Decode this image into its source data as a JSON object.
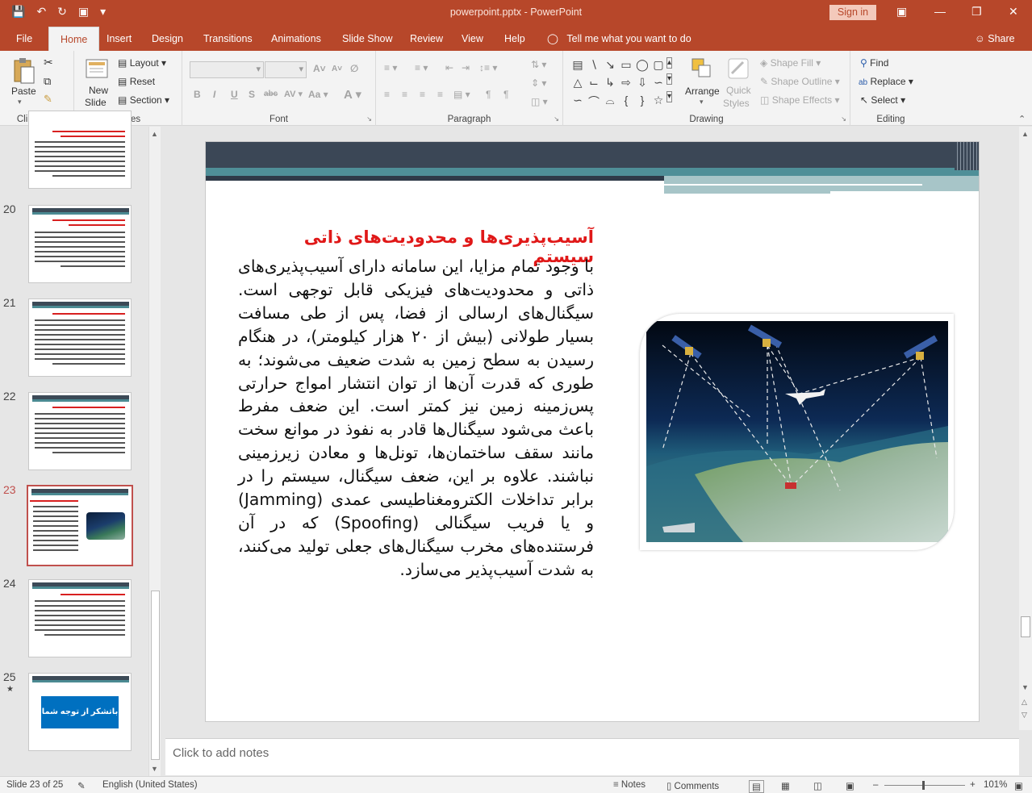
{
  "titlebar": {
    "title": "powerpoint.pptx - PowerPoint",
    "signin": "Sign in"
  },
  "tabs": [
    "File",
    "Home",
    "Insert",
    "Design",
    "Transitions",
    "Animations",
    "Slide Show",
    "Review",
    "View",
    "Help"
  ],
  "active_tab": "Home",
  "tellme": "Tell me what you want to do",
  "share": "Share",
  "ribbon": {
    "clipboard": {
      "label": "Clipboard",
      "paste": "Paste"
    },
    "slides": {
      "label": "Slides",
      "new_slide": "New",
      "new_slide2": "Slide",
      "layout": "Layout",
      "reset": "Reset",
      "section": "Section"
    },
    "font": {
      "label": "Font"
    },
    "paragraph": {
      "label": "Paragraph"
    },
    "drawing": {
      "label": "Drawing",
      "arrange": "Arrange",
      "quick_styles": "Quick",
      "quick_styles2": "Styles",
      "shape_fill": "Shape Fill",
      "shape_outline": "Shape Outline",
      "shape_effects": "Shape Effects"
    },
    "editing": {
      "label": "Editing",
      "find": "Find",
      "replace": "Replace",
      "select": "Select"
    }
  },
  "thumbnails": [
    {
      "num": "20"
    },
    {
      "num": "21"
    },
    {
      "num": "22"
    },
    {
      "num": "23"
    },
    {
      "num": "24"
    },
    {
      "num": "25",
      "text": "باتشکر از توجه شما"
    }
  ],
  "slide": {
    "title": "آسیب‌پذیری‌ها و محدودیت‌های ذاتی سیستم",
    "body": "با وجود تمام مزایا، این سامانه دارای آسیب‌پذیری‌های ذاتی و محدودیت‌های فیزیکی قابل توجهی است. سیگنال‌های ارسالی از فضا، پس از طی مسافت بسیار طولانی (بیش از ۲۰ هزار کیلومتر)، در هنگام رسیدن به سطح زمین به شدت ضعیف می‌شوند؛ به طوری که قدرت آن‌ها از توان انتشار امواج حرارتی پس‌زمینه زمین نیز کمتر است. این ضعف مفرط باعث می‌شود سیگنال‌ها قادر به نفوذ در موانع سخت مانند سقف ساختمان‌ها، تونل‌ها و معادن زیرزمینی نباشند. علاوه بر این، ضعف سیگنال، سیستم را در برابر تداخلات الکترومغناطیسی عمدی (Jamming) و یا فریب سیگنالی (Spoofing) که در آن فرستنده‌های مخرب سیگنال‌های جعلی تولید می‌کنند، به شدت آسیب‌پذیر می‌سازد."
  },
  "notes": {
    "placeholder": "Click to add notes"
  },
  "statusbar": {
    "slide_count": "Slide 23 of 25",
    "language": "English (United States)",
    "notes": "Notes",
    "comments": "Comments",
    "zoom": "101%"
  }
}
